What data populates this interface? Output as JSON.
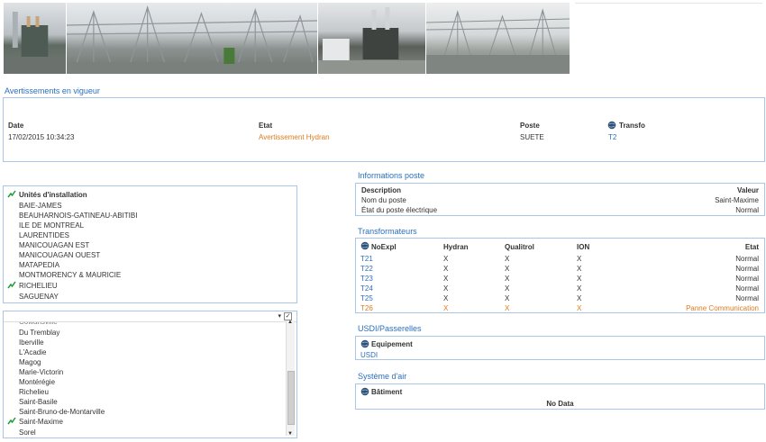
{
  "warnings": {
    "title": "Avertissements en vigueur",
    "headers": {
      "date": "Date",
      "etat": "Etat",
      "poste": "Poste",
      "transfo": "Transfo"
    },
    "row": {
      "date": "17/02/2015 10:34:23",
      "etat": "Avertissement Hydran",
      "poste": "SUETE",
      "transfo": "T2"
    }
  },
  "units": {
    "header": "Unités d'installation",
    "items": [
      "BAIE-JAMES",
      "BEAUHARNOIS-GATINEAU-ABITIBI",
      "ILE DE MONTREAL",
      "LAURENTIDES",
      "MANICOUAGAN EST",
      "MANICOUAGAN OUEST",
      "MATAPEDIA",
      "MONTMORENCY & MAURICIE",
      "RICHELIEU",
      "SAGUENAY"
    ],
    "selected": "RICHELIEU"
  },
  "stations": {
    "cut_item": "Cowansville",
    "items": [
      "Du Tremblay",
      "Iberville",
      "L'Acadie",
      "Magog",
      "Marie-Victorin",
      "Montérégie",
      "Richelieu",
      "Saint-Basile",
      "Saint-Bruno-de-Montarville",
      "Saint-Maxime",
      "Sorel"
    ],
    "selected": "Saint-Maxime",
    "checkbox_mark": "✓"
  },
  "info_poste": {
    "title": "Informations poste",
    "col_description": "Description",
    "col_valeur": "Valeur",
    "rows": [
      {
        "label": "Nom du poste",
        "value": "Saint-Maxime"
      },
      {
        "label": "État du poste électrique",
        "value": "Normal"
      }
    ]
  },
  "transformers": {
    "title": "Transformateurs",
    "headers": {
      "noexpl": "NoExpl",
      "hydran": "Hydran",
      "qualitrol": "Qualitrol",
      "ion": "ION",
      "etat": "Etat"
    },
    "rows": [
      {
        "name": "T21",
        "hydran": "X",
        "qualitrol": "X",
        "ion": "X",
        "etat": "Normal",
        "alert": false
      },
      {
        "name": "T22",
        "hydran": "X",
        "qualitrol": "X",
        "ion": "X",
        "etat": "Normal",
        "alert": false
      },
      {
        "name": "T23",
        "hydran": "X",
        "qualitrol": "X",
        "ion": "X",
        "etat": "Normal",
        "alert": false
      },
      {
        "name": "T24",
        "hydran": "X",
        "qualitrol": "X",
        "ion": "X",
        "etat": "Normal",
        "alert": false
      },
      {
        "name": "T25",
        "hydran": "X",
        "qualitrol": "X",
        "ion": "X",
        "etat": "Normal",
        "alert": false
      },
      {
        "name": "T26",
        "hydran": "X",
        "qualitrol": "X",
        "ion": "X",
        "etat": "Panne Communication",
        "alert": true
      }
    ]
  },
  "usdi": {
    "title": "USDI/Passerelles",
    "header": "Equipement",
    "item": "USDI"
  },
  "air": {
    "title": "Système d'air",
    "header": "Bâtiment",
    "empty": "No Data"
  },
  "colors": {
    "accent": "#2a6fbf",
    "alert": "#e07b1a",
    "border": "#a9c6e8",
    "check": "#1e9e3a"
  }
}
